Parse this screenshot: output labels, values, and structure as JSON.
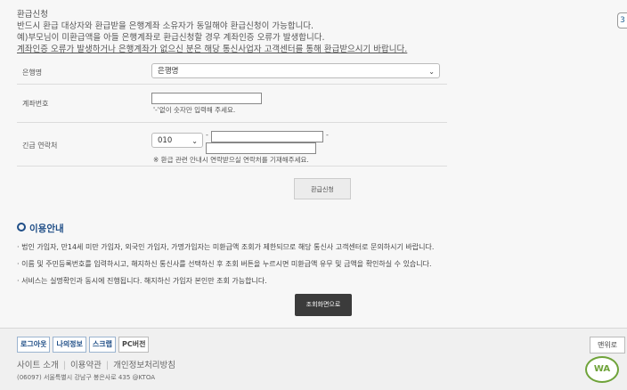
{
  "intro": {
    "title": "환급신청",
    "line1": "반드시 환급 대상자와 환급받을 은행계좌 소유자가 동일해야 환급신청이 가능합니다.",
    "line2": "예)부모님이 미환급액을 아들 은행계좌로 환급신청할 경우 계좌인증 오류가 발생합니다.",
    "line3": "계좌인증 오류가 발생하거나 은행계좌가 없으신 분은 해당 통신사업자 고객센터를 통해 환급받으시기 바랍니다."
  },
  "form": {
    "bank_label": "은행명",
    "bank_selected": "은행명",
    "account_label": "계좌번호",
    "account_note": "'-'없이 숫자만 입력해 주세요.",
    "contact_label": "긴급 연락처",
    "phone_prefix": "010",
    "contact_note": "※ 환급 관련 안내시 연락받으실 연락처를 기재해주세요.",
    "refund_button": "환급신청"
  },
  "guide": {
    "title": "이용안내",
    "item1": "· 법인 가입자, 만14세 미만 가입자, 외국인 가입자, 가명가입자는 미환급액 조회가 제한되므로 해당 통신사 고객센터로 문의하시기 바랍니다.",
    "item2": "· 이름 및 주민등록번호를 입력하시고, 해지하신 통신사를 선택하신 후 조회 버튼을 누르시면 미환급액 유무 및 금액을 확인하실 수 있습니다.",
    "item3": "· 서비스는 실명확인과 동시에 진행됩니다. 해지하신 가입자 본인만 조회 가능합니다.",
    "search_button": "조회화면으로"
  },
  "footer": {
    "logout": "로그아웃",
    "myinfo": "나의정보",
    "scrap": "스크랩",
    "pc": "PC버전",
    "top": "맨위로",
    "site_intro": "사이트 소개",
    "terms": "이용약관",
    "privacy": "개인정보처리방침",
    "address": "(06097) 서울특별시 강남구 봉은사로 435 @KTOA",
    "wa_mark": "WA"
  },
  "colors": {
    "accent": "#1f4e87",
    "dark_button": "#3b3b3b",
    "wa_green": "#6fa33a"
  }
}
